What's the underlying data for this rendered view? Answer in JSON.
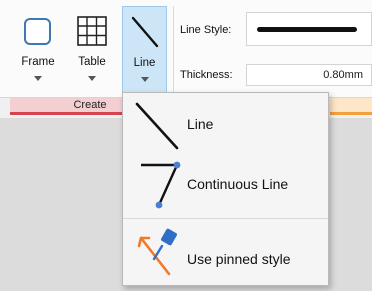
{
  "toolbar": {
    "frame_label": "Frame",
    "table_label": "Table",
    "line_label": "Line"
  },
  "properties": {
    "line_style_label": "Line Style:",
    "thickness_label": "Thickness:",
    "thickness_value": "0.80mm"
  },
  "group": {
    "create_label": "Create"
  },
  "dropdown": {
    "items": [
      {
        "label": "Line",
        "icon": "diagonal-line-icon"
      },
      {
        "label": "Continuous Line",
        "icon": "polyline-icon"
      },
      {
        "label": "Use pinned style",
        "icon": "pin-icon"
      }
    ]
  },
  "colors": {
    "accent": "#cde6f7",
    "group_red": "#d3454f",
    "group_orange": "#f1a23e",
    "icon_blue": "#3c78b4",
    "pin_orange": "#f07a2a"
  }
}
